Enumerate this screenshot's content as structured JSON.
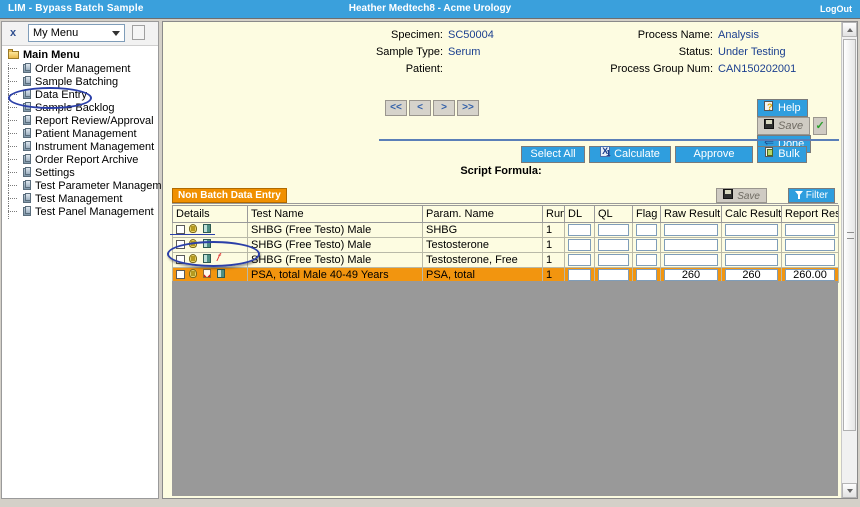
{
  "titlebar": {
    "app_title": "LIM - Bypass Batch Sample",
    "user_org": "Heather Medtech8   -   Acme Urology",
    "logout_label": "LogOut"
  },
  "sidebar": {
    "close_label": "x",
    "menu_select_value": "My Menu",
    "root_label": "Main Menu",
    "items": [
      {
        "label": "Order Management"
      },
      {
        "label": "Sample Batching"
      },
      {
        "label": "Data Entry"
      },
      {
        "label": "Sample Backlog"
      },
      {
        "label": "Report Review/Approval"
      },
      {
        "label": "Patient Management"
      },
      {
        "label": "Instrument Management"
      },
      {
        "label": "Order Report Archive"
      },
      {
        "label": "Settings"
      },
      {
        "label": "Test Parameter Management"
      },
      {
        "label": "Test Management"
      },
      {
        "label": "Test Panel Management"
      }
    ]
  },
  "info": {
    "specimen_label": "Specimen:",
    "specimen_value": "SC50004",
    "sample_type_label": "Sample Type:",
    "sample_type_value": "Serum",
    "patient_label": "Patient:",
    "patient_value": "",
    "process_name_label": "Process Name:",
    "process_name_value": "Analysis",
    "status_label": "Status:",
    "status_value": "Under Testing",
    "process_group_label": "Process Group Num:",
    "process_group_value": "CAN150202001"
  },
  "nav": {
    "first_label": "<<",
    "prev_label": "<",
    "next_label": ">",
    "last_label": ">>"
  },
  "topbuttons": {
    "help_label": "Help",
    "save_label": "Save",
    "done_label": "Done",
    "check_glyph": "✓"
  },
  "actions": {
    "select_all_label": "Select All",
    "calculate_label": "Calculate",
    "approve_label": "Approve",
    "bulk_label": "Bulk",
    "script_formula_label": "Script Formula:"
  },
  "gridtoolbar": {
    "tab_label": "Non Batch Data Entry",
    "save_label": "Save",
    "filter_label": "Filter"
  },
  "grid": {
    "columns": [
      "Details",
      "Test Name",
      "Param. Name",
      "Run",
      "DL",
      "QL",
      "Flag",
      "Raw Result",
      "Calc Result",
      "Report Res"
    ],
    "rows": [
      {
        "selected": false,
        "icons": [
          "specimen-icon",
          "book-icon"
        ],
        "test_name": "SHBG (Free Testo) Male",
        "param_name": "SHBG",
        "run": "1",
        "dl": "",
        "ql": "",
        "flag": "",
        "raw_result": "",
        "calc_result": "",
        "report_result": "",
        "has_inputs": false
      },
      {
        "selected": false,
        "icons": [
          "specimen-icon",
          "book-icon"
        ],
        "test_name": "SHBG (Free Testo) Male",
        "param_name": "Testosterone",
        "run": "1",
        "dl": "",
        "ql": "",
        "flag": "",
        "raw_result": "",
        "calc_result": "",
        "report_result": "",
        "has_inputs": false
      },
      {
        "selected": false,
        "icons": [
          "specimen-icon",
          "book-icon",
          "formula-icon"
        ],
        "test_name": "SHBG (Free Testo) Male",
        "param_name": "Testosterone, Free",
        "run": "1",
        "dl": "",
        "ql": "",
        "flag": "",
        "raw_result": "",
        "calc_result": "",
        "report_result": "",
        "has_inputs": false
      },
      {
        "selected": true,
        "icons": [
          "specimen-icon",
          "chart-icon",
          "book-icon"
        ],
        "test_name": "PSA, total Male 40-49 Years",
        "param_name": "PSA, total",
        "run": "1",
        "dl": "",
        "ql": "",
        "flag": "",
        "raw_result": "260",
        "calc_result": "260",
        "report_result": "260.00",
        "has_inputs": true
      }
    ]
  },
  "annotations": [
    {
      "name": "data-entry-highlight"
    },
    {
      "name": "psa-row-highlight"
    }
  ],
  "colors": {
    "titlebar": "#3aa0dc",
    "accent_blue": "#2f9ede",
    "tab_orange": "#f09000",
    "row_selected": "#f2950f",
    "page_bg": "#fdfce1",
    "value_text": "#1b3f8f",
    "annotation": "#2b3fa8"
  }
}
